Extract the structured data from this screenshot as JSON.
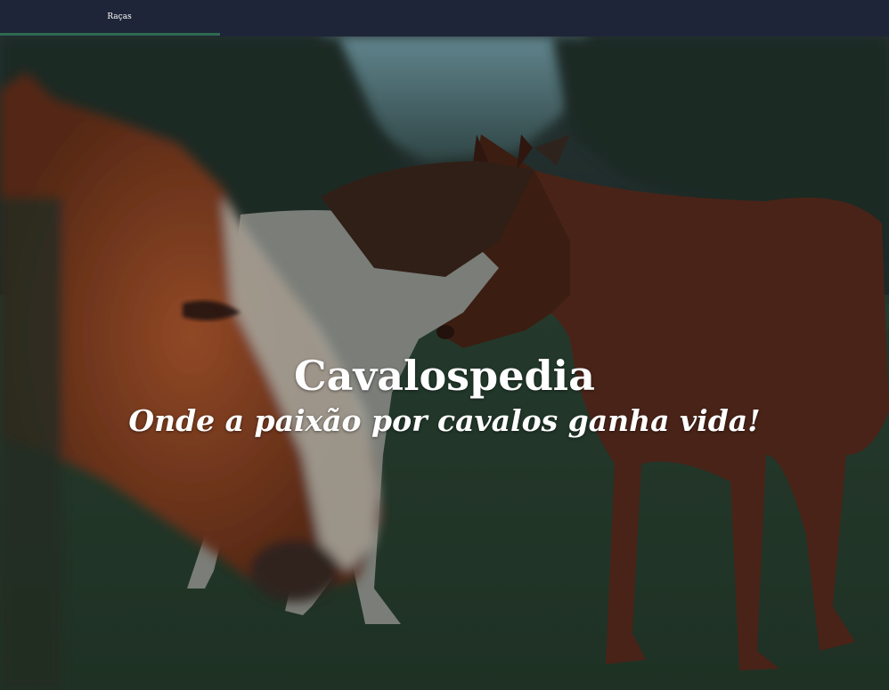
{
  "nav": {
    "items": [
      {
        "label": "Raças"
      }
    ],
    "active_color": "#2d6b4f",
    "background": "#1f2538"
  },
  "hero": {
    "title": "Cavalospedia",
    "subtitle": "Onde a paixão por cavalos ganha vida!",
    "image": "horses-in-misty-field"
  }
}
